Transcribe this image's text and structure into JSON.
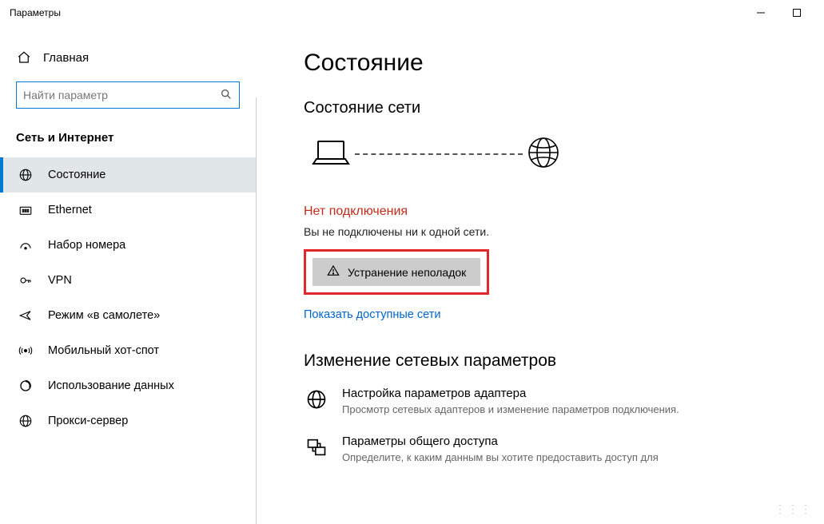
{
  "window": {
    "title": "Параметры"
  },
  "sidebar": {
    "home_label": "Главная",
    "search_placeholder": "Найти параметр",
    "category": "Сеть и Интернет",
    "items": [
      {
        "label": "Состояние"
      },
      {
        "label": "Ethernet"
      },
      {
        "label": "Набор номера"
      },
      {
        "label": "VPN"
      },
      {
        "label": "Режим «в самолете»"
      },
      {
        "label": "Мобильный хот-спот"
      },
      {
        "label": "Использование данных"
      },
      {
        "label": "Прокси-сервер"
      }
    ]
  },
  "main": {
    "title": "Состояние",
    "network_status_heading": "Состояние сети",
    "no_connection_heading": "Нет подключения",
    "no_connection_text": "Вы не подключены ни к одной сети.",
    "troubleshoot_label": "Устранение неполадок",
    "show_networks_link": "Показать доступные сети",
    "change_settings_heading": "Изменение сетевых параметров",
    "adapter": {
      "title": "Настройка параметров адаптера",
      "desc": "Просмотр сетевых адаптеров и изменение параметров подключения."
    },
    "sharing": {
      "title": "Параметры общего доступа",
      "desc": "Определите, к каким данным вы хотите предоставить доступ для"
    }
  }
}
